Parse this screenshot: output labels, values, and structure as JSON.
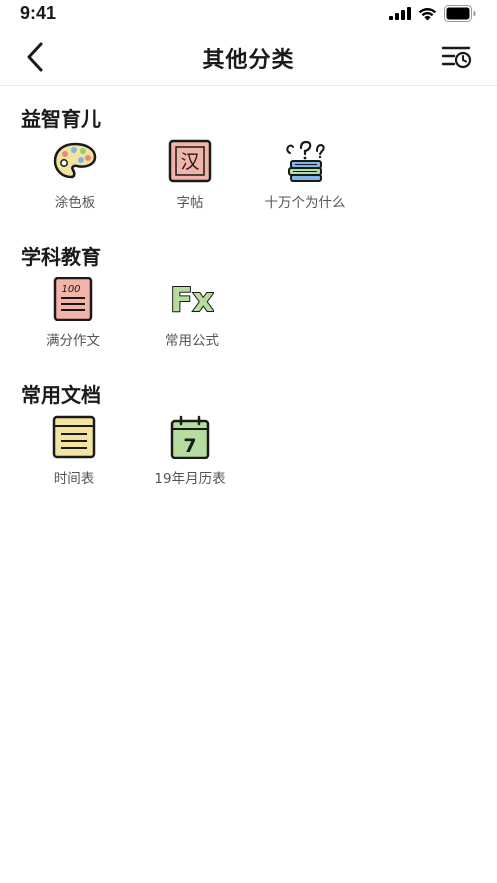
{
  "status_bar": {
    "time": "9:41"
  },
  "nav": {
    "title": "其他分类"
  },
  "sections": [
    {
      "title": "益智育儿",
      "items": [
        {
          "label": "涂色板",
          "icon": "palette-icon"
        },
        {
          "label": "字帖",
          "icon": "copybook-icon"
        },
        {
          "label": "十万个为什么",
          "icon": "question-books-icon"
        }
      ]
    },
    {
      "title": "学科教育",
      "items": [
        {
          "label": "满分作文",
          "icon": "essay-100-icon"
        },
        {
          "label": "常用公式",
          "icon": "fx-formula-icon"
        }
      ]
    },
    {
      "title": "常用文档",
      "items": [
        {
          "label": "时间表",
          "icon": "timetable-icon"
        },
        {
          "label": "19年月历表",
          "icon": "calendar-icon"
        }
      ]
    }
  ],
  "icon_text": {
    "copybook_char": "汉",
    "essay_score": "100",
    "formula": "Fx",
    "calendar_day": "7"
  },
  "colors": {
    "pink": "#f2b3a8",
    "yellow": "#f3e3a1",
    "green": "#b7dc9f",
    "outline": "#1a1a1a"
  }
}
